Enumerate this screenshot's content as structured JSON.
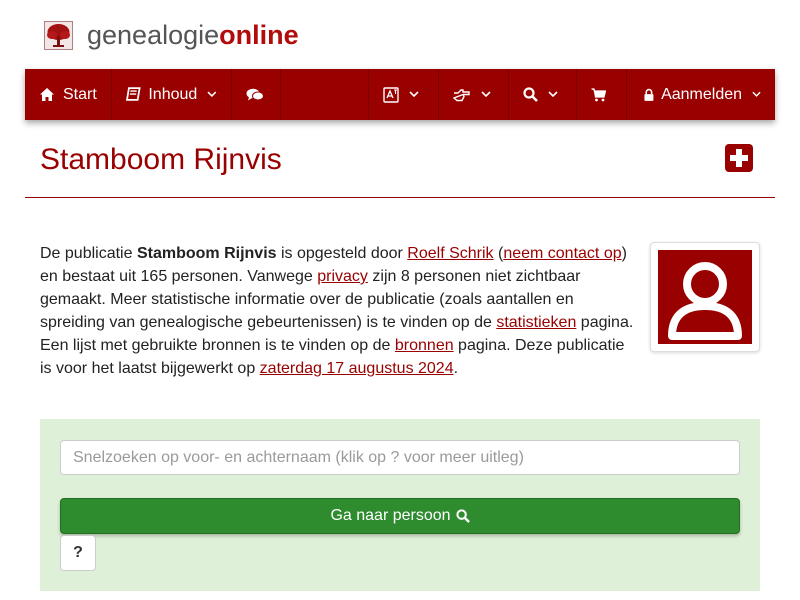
{
  "header": {
    "logo_part1": "genealogie",
    "logo_part2": "online",
    "logo_icon": "tree-icon"
  },
  "nav": {
    "start_label": "Start",
    "inhoud_label": "Inhoud",
    "login_label": "Aanmelden",
    "icons": [
      "home-icon",
      "book-icon",
      "comments-icon",
      "language-icon",
      "hand-point-icon",
      "search-icon",
      "cart-icon",
      "lock-icon"
    ]
  },
  "page": {
    "title": "Stamboom Rijnvis"
  },
  "intro": {
    "t1": "De publicatie ",
    "pub_name": "Stamboom Rijnvis",
    "t2": " is opgesteld door ",
    "author": "Roelf Schrik",
    "t3": " (",
    "contact": "neem contact op",
    "t4": ") en bestaat uit 165 personen. Vanwege ",
    "privacy": "privacy",
    "t5": " zijn 8 personen niet zichtbaar gemaakt. Meer statistische informatie over de publicatie (zoals aantallen en spreiding van genealogische gebeurtenissen) is te vinden op de ",
    "stats": "statistieken",
    "t6": " pagina. Een lijst met gebruikte bronnen is te vinden op de ",
    "sources": "bronnen",
    "t7": " pagina. Deze publicatie is voor het laatst bijgewerkt op ",
    "updated": "zaterdag 17 augustus 2024",
    "t8": "."
  },
  "search": {
    "placeholder": "Snelzoeken op voor- en achternaam (klik op ? voor meer uitleg)",
    "button_label": "Ga naar persoon",
    "help_label": "?"
  },
  "colors": {
    "brand": "#990000",
    "panel": "#dff0d8",
    "button": "#2e8b2e"
  }
}
